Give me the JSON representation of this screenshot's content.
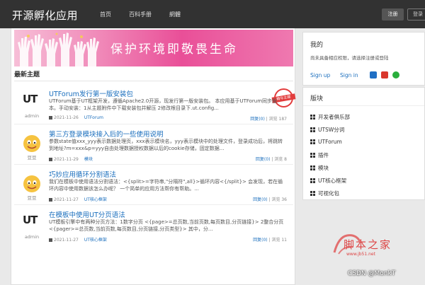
{
  "nav": {
    "logo": "开源孵化应用",
    "links": [
      "首页",
      "百科手册",
      "網體"
    ],
    "register": "注册",
    "login": "登录"
  },
  "banner": {
    "text": "保护环境即敬畏生命"
  },
  "main": {
    "section_title": "最新主题",
    "topics": [
      {
        "avatar": "UT",
        "author": "admin",
        "title": "UTForum发行第一版安装包",
        "excerpt": "UTForum基于UT框架开发，遵循Apache2.0开源，现发行第一版安装包。 本应用基于UTForum同步版本。手动安装：1从主题附件中下载安装包并解压 2修改根目录下.ut.config...",
        "date": "2021-11-26",
        "category": "UTForum",
        "stats_replies": "回复(0)",
        "stats_views": "浏览 187",
        "stamp": "精华主题"
      },
      {
        "avatar": "emoji",
        "author": "豆豆",
        "title": "第三方登录模块接入后的一些使用说明",
        "excerpt": "参数state值xxx_yyy表示数据处理页，xxx表示模块名，yyy表示模块中的处理文件，登录成功后，将跳转到地址?m=xxx&p=yyy自由处理数据授权数据以后的cookie存储，固定数据...",
        "date": "2021-11-29",
        "category": "模块",
        "stats_replies": "回复(0)",
        "stats_views": "浏览 8",
        "stamp": ""
      },
      {
        "avatar": "emoji",
        "author": "豆豆",
        "title": "巧妙应用循环分割语法",
        "excerpt": "我们在模板中使用语法分割语法：<{split>=字符串,\"分隔符\",all}>循环内容<{/split}> 会发现，若在循环内容中使用数据该怎么办呢？ 一个简单的应用方法帮你有帮助。...",
        "date": "2021-11-27",
        "category": "UT核心框架",
        "stats_replies": "回复(0)",
        "stats_views": "浏览 36",
        "stamp": ""
      },
      {
        "avatar": "UT",
        "author": "admin",
        "title": "在模板中使用UT分页语法",
        "excerpt": "UT模板引擎中有两种分页方法：1数字分页 <{page>=总页数,当前页数,每页数目,分页链接}> 2整合分页 <{pager>=总页数,当前页数,每页数目,分页链接,分页类型}> 其中，分...",
        "date": "2021-11-27",
        "category": "UT核心框架",
        "stats_replies": "回复(0)",
        "stats_views": "浏览 11",
        "stamp": ""
      }
    ]
  },
  "sidebar": {
    "me": {
      "title": "我的",
      "text": "尚未具备相应权限，请选择注册或登陆",
      "signup": "Sign up",
      "signin": "Sign in",
      "social": [
        "qq-icon",
        "weibo-icon",
        "wechat-icon"
      ]
    },
    "sections": {
      "title": "版块",
      "items": [
        "开发者俱乐部",
        "UTSW分词",
        "UTForum",
        "插件",
        "模块",
        "UT核心框架",
        "可视化包"
      ]
    }
  },
  "watermark": {
    "site": "脚本之家",
    "url": "www.jb51.net",
    "csdn": "CSDN @MonkT"
  },
  "colors": {
    "topbar": "#323232",
    "link": "#1a6ebd",
    "banner": "#e94f98",
    "stamp": "#e23c3c"
  }
}
